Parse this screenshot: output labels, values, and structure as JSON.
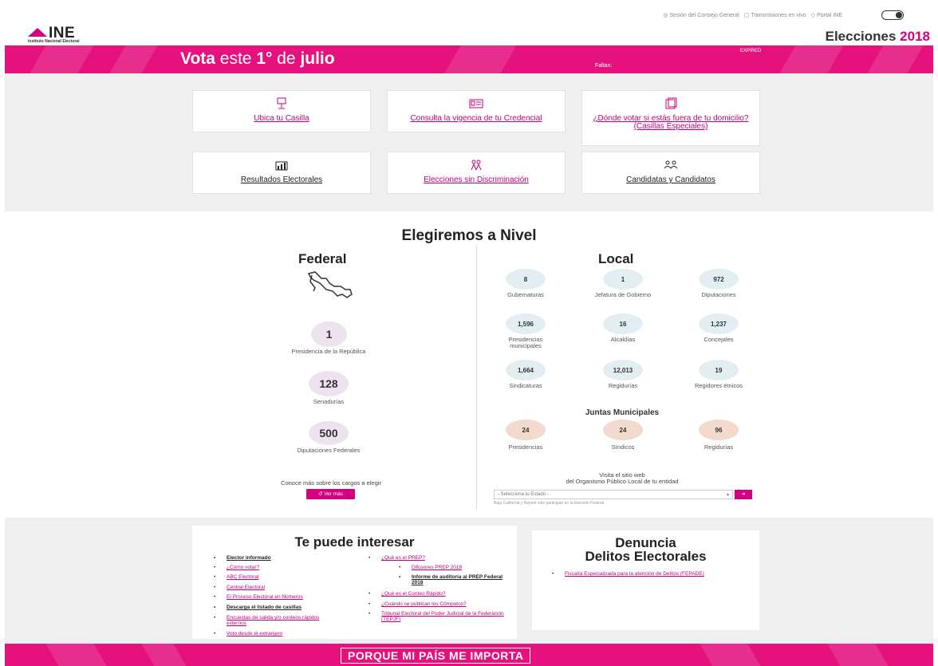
{
  "top_links": [
    "Sesión del Consejo General",
    "Transmisiones en vivo",
    "Portal INE"
  ],
  "brand": {
    "logo": "INE",
    "logo_sub": "Instituto Nacional Electoral",
    "elecciones": "Elecciones",
    "year": "2018"
  },
  "banner": {
    "vota_bold": "Vota",
    "vota_mid": " este ",
    "vota_day": "1°",
    "vota_de": " de ",
    "vota_month": "julio",
    "faltan": "Faltan:",
    "expired": "EXPIRED"
  },
  "cards": [
    {
      "label": "Ubica tu Casilla",
      "icon": "ballot-box-icon"
    },
    {
      "label": "Consulta la vigencia de tu Credencial",
      "icon": "id-card-icon"
    },
    {
      "label": "¿Dónde votar si estás fuera de tu domicilio? (Casillas Especiales)",
      "icon": "building-icon"
    },
    {
      "label": "Resultados Electorales",
      "icon": "bar-chart-icon"
    },
    {
      "label": "Elecciones sin Discriminación",
      "icon": "people-icon"
    },
    {
      "label": "Candidatas y Candidatos",
      "icon": "candidates-icon"
    }
  ],
  "nivel": {
    "title": "Elegiremos a Nivel",
    "federal_title": "Federal",
    "local_title": "Local",
    "federal": [
      {
        "value": "1",
        "label": "Presidencia de la República"
      },
      {
        "value": "128",
        "label": "Senadurías"
      },
      {
        "value": "500",
        "label": "Diputaciones Federales"
      }
    ],
    "local": [
      {
        "value": "8",
        "label": "Gubernaturas"
      },
      {
        "value": "1",
        "label": "Jefatura de Gobierno"
      },
      {
        "value": "972",
        "label": "Diputaciones"
      },
      {
        "value": "1,596",
        "label": "Presidencias municipales"
      },
      {
        "value": "16",
        "label": "Alcaldías"
      },
      {
        "value": "1,237",
        "label": "Concejales"
      },
      {
        "value": "1,664",
        "label": "Sindicaturas"
      },
      {
        "value": "12,013",
        "label": "Regidurías"
      },
      {
        "value": "19",
        "label": "Regidores étnicos"
      }
    ],
    "juntas_title": "Juntas Municipales",
    "juntas": [
      {
        "value": "24",
        "label": "Presidencias"
      },
      {
        "value": "24",
        "label": "Síndicos"
      },
      {
        "value": "96",
        "label": "Regidurías"
      }
    ],
    "conoce": "Conoce más sobre los cargos a elegir",
    "ver_mas": "Ver más",
    "visita_1": "Visita el sitio web",
    "visita_2": "del Organismo Público Local de tu entidad",
    "select_placeholder": "- Selecciona tu Estado -",
    "baja_note": "Baja California y Nayarit sólo participan en la Elección Federal"
  },
  "interesar": {
    "title": "Te puede interesar",
    "col1": [
      {
        "text": "Elector informado",
        "style": "dark"
      },
      {
        "text": "¿Cómo votar?",
        "style": "pink"
      },
      {
        "text": "ABC Electoral",
        "style": "pink"
      },
      {
        "text": "Central Electoral",
        "style": "pink"
      },
      {
        "text": "El Proceso Electoral en Números",
        "style": "pink"
      },
      {
        "text": "Descarga el listado de casillas",
        "style": "dark"
      },
      {
        "text": "Encuestas de salida y/o conteos rápidos externos",
        "style": "pink"
      },
      {
        "text": "Voto desde el extranjero",
        "style": "pink"
      }
    ],
    "col2": [
      {
        "text": "¿Qué es el PREP?",
        "style": "pink"
      },
      {
        "text": "Difusores PREP 2018",
        "style": "pink"
      },
      {
        "text": "Informe de auditoría al PREP Federal 2018",
        "style": "dark"
      },
      {
        "text": "¿Qué es el Conteo Rápido?",
        "style": "pink"
      },
      {
        "text": "¿Cuándo se publican los Cómputos?",
        "style": "pink"
      },
      {
        "text": "Tribunal Electoral del Poder Judicial de la Federación (TEPJF)",
        "style": "pink"
      }
    ]
  },
  "denuncia": {
    "title_1": "Denuncia",
    "title_2": "Delitos Electorales",
    "link": "Fiscalía Especializada para la atención de Delitos (FEPADE)"
  },
  "footer": {
    "slogan": "PORQUE MI PAÍS ME IMPORTA"
  },
  "colors": {
    "accent": "#D5007F",
    "banner": "#E5127D",
    "grey": "#EFEFEF"
  }
}
